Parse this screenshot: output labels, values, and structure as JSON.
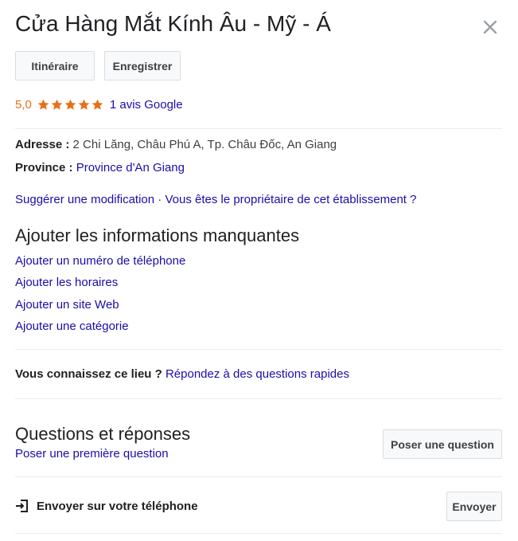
{
  "place": {
    "title": "Cửa Hàng Mắt Kính Âu - Mỹ - Á",
    "close_icon": "close-icon"
  },
  "actions": {
    "itinerary": "Itinéraire",
    "save": "Enregistrer"
  },
  "rating": {
    "value": "5,0",
    "stars": 5,
    "star_color": "#e7711b",
    "reviews_link": "1 avis Google"
  },
  "info": {
    "address_label": "Adresse :",
    "address_value": "2 Chi Lăng, Châu Phú A, Tp. Châu Đốc, An Giang",
    "province_label": "Province :",
    "province_value": "Province d'An Giang"
  },
  "edit": {
    "suggest": "Suggérer une modification",
    "separator": "·",
    "owner": "Vous êtes le propriétaire de cet établissement ?"
  },
  "missing": {
    "title": "Ajouter les informations manquantes",
    "links": [
      "Ajouter un numéro de téléphone",
      "Ajouter les horaires",
      "Ajouter un site Web",
      "Ajouter une catégorie"
    ]
  },
  "know": {
    "question": "Vous connaissez ce lieu ?",
    "link": "Répondez à des questions rapides"
  },
  "qa": {
    "title": "Questions et réponses",
    "first_question_link": "Poser une première question",
    "ask_button": "Poser une question"
  },
  "send": {
    "icon": "send-to-phone-icon",
    "label": "Envoyer sur votre téléphone",
    "button": "Envoyer"
  },
  "colors": {
    "link": "#1a0dab",
    "rating": "#e7711b",
    "text": "#202124"
  }
}
